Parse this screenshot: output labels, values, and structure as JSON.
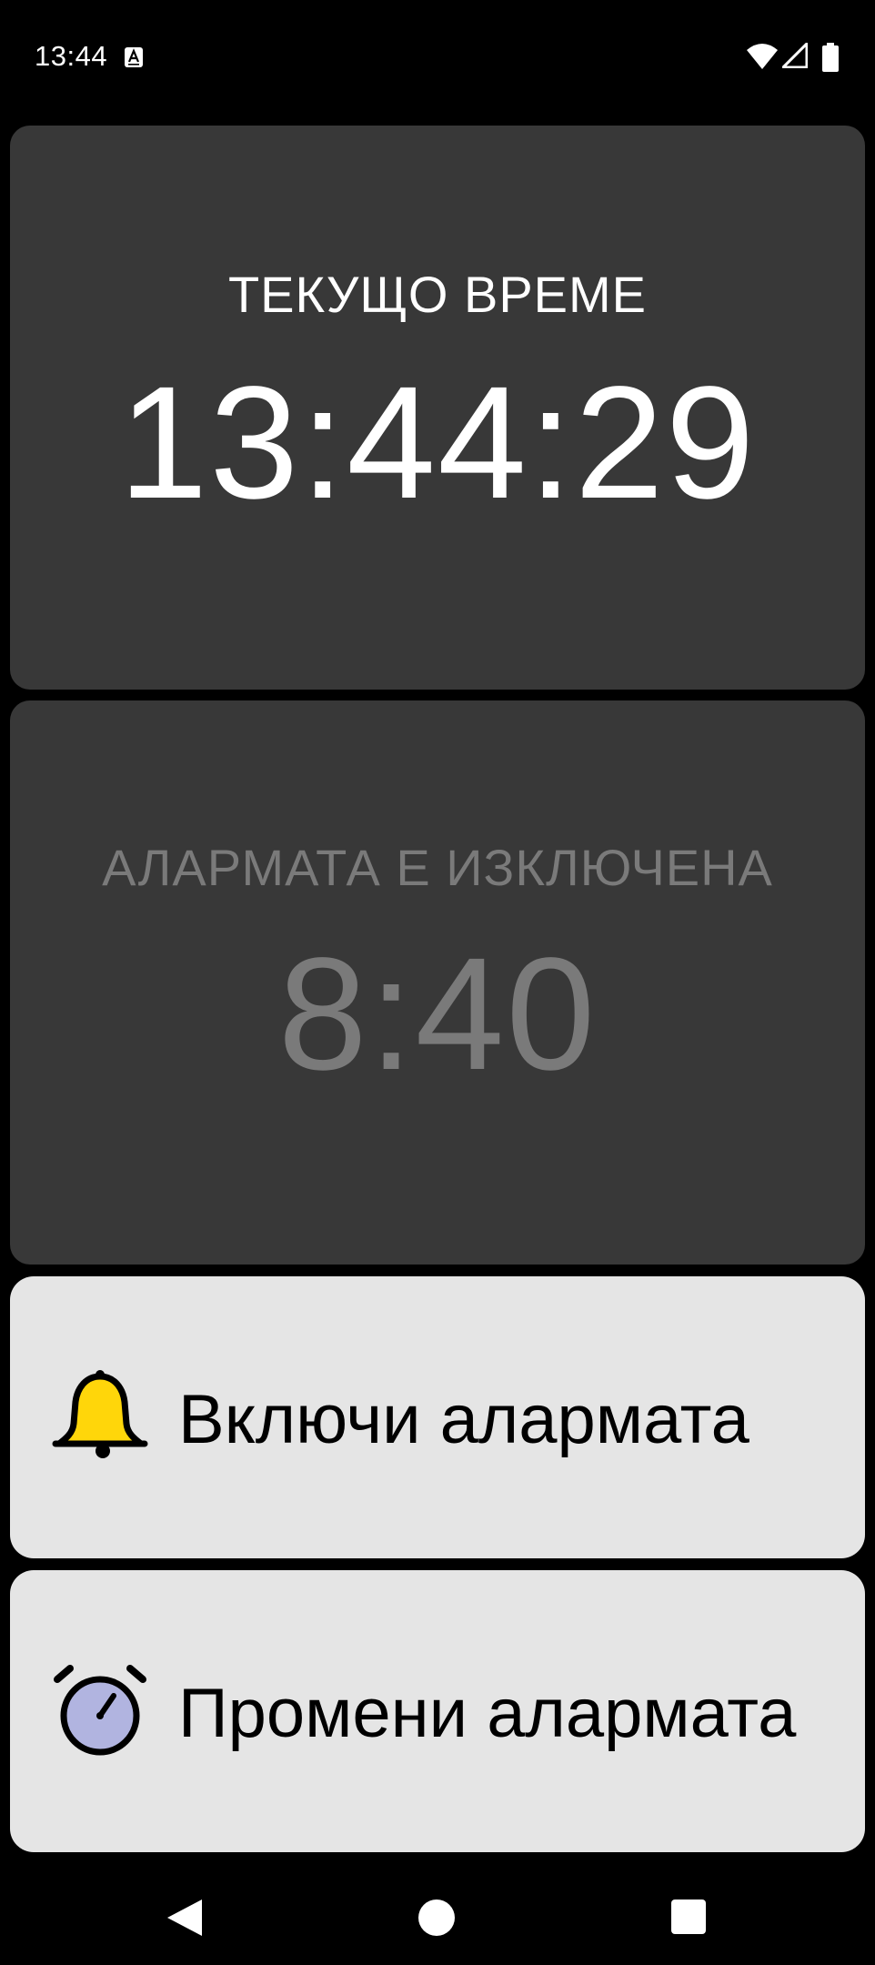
{
  "status_bar": {
    "time": "13:44",
    "notification_icon": "font-icon",
    "icons": [
      "wifi-icon",
      "cellular-signal-icon",
      "battery-icon"
    ]
  },
  "current_time_card": {
    "label": "ТЕКУЩО ВРЕМЕ",
    "value": "13:44:29"
  },
  "alarm_card": {
    "label": "АЛАРМАТА Е ИЗКЛЮЧЕНА",
    "value": "8:40",
    "color": "#7a7a7a"
  },
  "actions": {
    "enable_alarm": {
      "label": "Включи алармата",
      "icon": "bell-icon",
      "icon_color": "#ffd60a"
    },
    "change_alarm": {
      "label": "Промени алармата",
      "icon": "alarm-clock-icon",
      "icon_color": "#b1b4e0"
    }
  },
  "nav_bar": {
    "buttons": [
      "back-icon",
      "home-icon",
      "recents-icon"
    ]
  },
  "colors": {
    "background": "#000000",
    "card": "#383838",
    "button": "#e5e5e5"
  }
}
